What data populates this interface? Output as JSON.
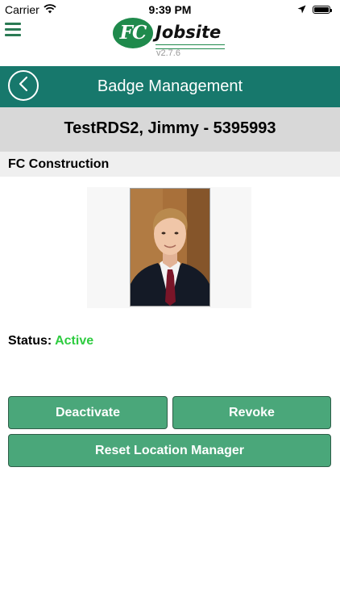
{
  "status_bar": {
    "carrier": "Carrier",
    "time": "9:39 PM",
    "icons": [
      "wifi-icon",
      "location-arrow-icon",
      "battery-icon"
    ]
  },
  "header": {
    "logo_mark": "FC",
    "logo_text": "Jobsite",
    "version": "v2.7.6",
    "menu_icon": "hamburger-menu-icon"
  },
  "titlebar": {
    "title": "Badge Management",
    "back_icon": "back-chevron-icon"
  },
  "employee": {
    "name_line": "TestRDS2, Jimmy - 5395993",
    "company": "FC Construction",
    "status_label": "Status:",
    "status_value": "Active"
  },
  "actions": {
    "deactivate": "Deactivate",
    "revoke": "Revoke",
    "reset_location_manager": "Reset Location Manager"
  },
  "colors": {
    "header_teal": "#17786c",
    "button_green": "#4aa77a",
    "status_active": "#2ecc40",
    "brand_green": "#1f8a4c"
  }
}
